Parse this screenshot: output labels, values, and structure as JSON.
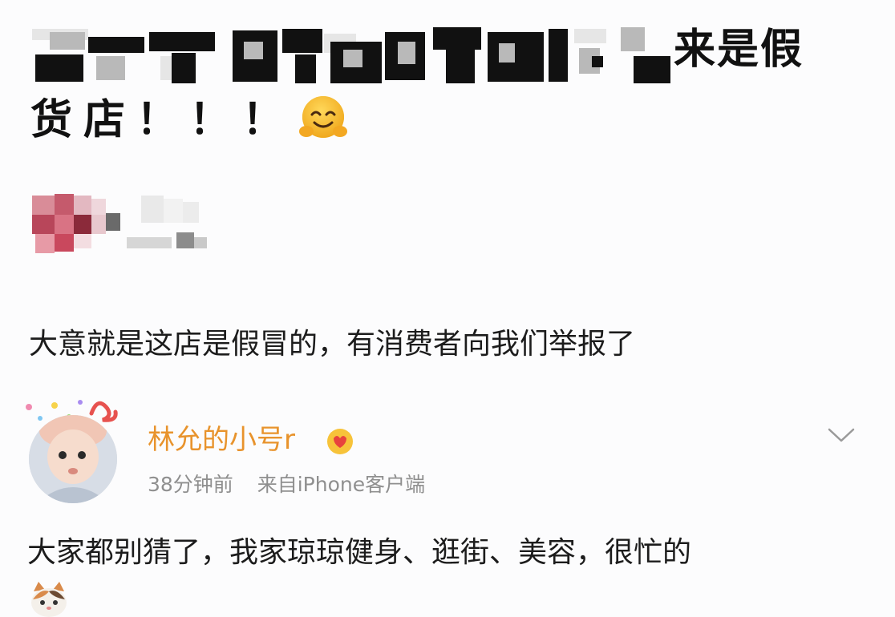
{
  "post": {
    "title_line1_visible": "来是假",
    "title_line2": "货店！！！"
  },
  "reply": {
    "text": "大意就是这店是假冒的，有消费者向我们举报了"
  },
  "comment": {
    "username": "林允的小号r",
    "time": "38分钟前",
    "source": "来自iPhone客户端",
    "text": "大家都别猜了，我家琼琼健身、逛街、美容，很忙的"
  },
  "icons": {
    "hug_emoji": "hugging-face-icon",
    "vip_badge": "vip-heart-badge-icon",
    "chevron": "chevron-down-icon",
    "cat_emoji": "cat-emoji-icon"
  }
}
